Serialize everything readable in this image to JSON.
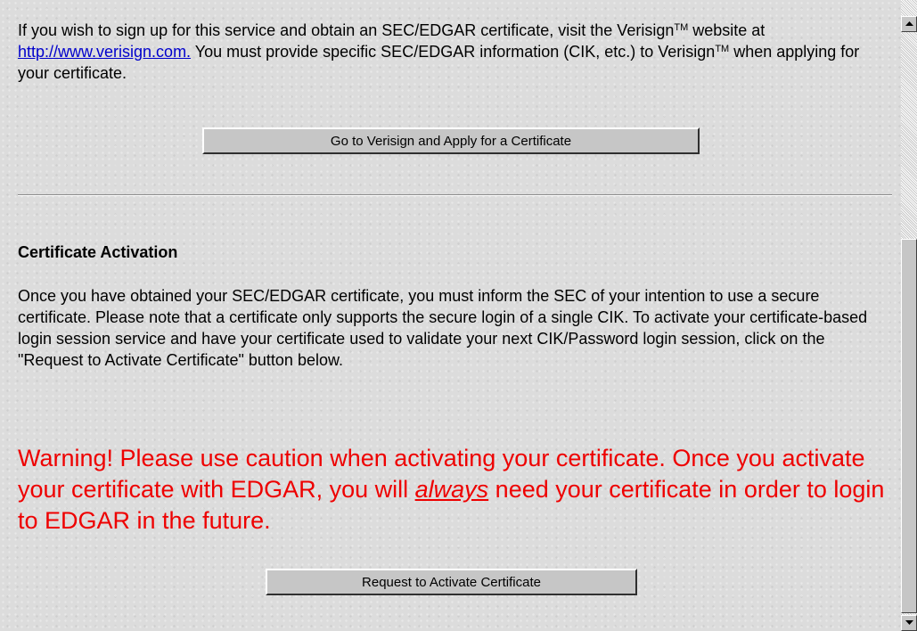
{
  "intro": {
    "text_1": "If you wish to sign up for this service and obtain an SEC/EDGAR certificate, visit the Verisign",
    "tm_1": "TM",
    "text_2": " website at ",
    "link": "http://www.verisign.com.",
    "text_3": " You must provide specific SEC/EDGAR information (CIK, etc.) to Verisign",
    "tm_2": "TM",
    "text_4": " when applying for your certificate."
  },
  "buttons": {
    "verisign": "Go to Verisign and Apply for a Certificate",
    "activate": "Request to Activate Certificate"
  },
  "activation": {
    "heading": "Certificate Activation",
    "body": "Once you have obtained your SEC/EDGAR certificate, you must inform the SEC of your intention to use a secure certificate. Please note that a certificate only supports the secure login of a single CIK. To activate your certificate-based login session service and have your certificate used to validate your next CIK/Password login session, click on the \"Request to Activate Certificate\" button below."
  },
  "warning": {
    "part_1": "Warning! Please use caution when activating your certificate. Once you activate your certificate with EDGAR, you will ",
    "emphasis": "always",
    "part_2": " need your certificate in order to login to EDGAR in the future."
  },
  "colors": {
    "warning": "#ee0000",
    "link": "#0000cc",
    "background": "#dcdcdc"
  },
  "icons": {
    "scroll_up": "up-arrow-icon",
    "scroll_down": "down-arrow-icon"
  }
}
